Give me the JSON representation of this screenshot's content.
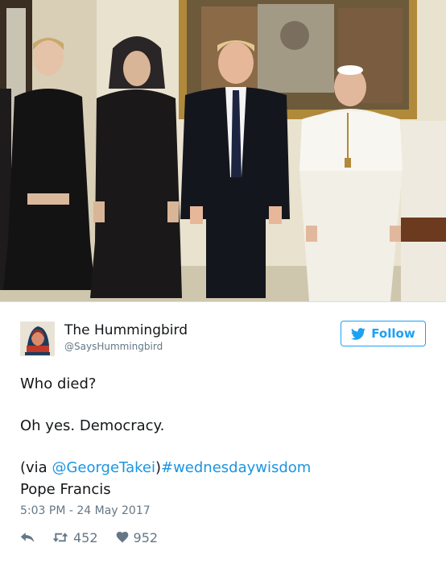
{
  "photo": {
    "subject": "photograph-of-four-people"
  },
  "tweet": {
    "author_name": "The Hummingbird",
    "author_handle": "@SaysHummingbird",
    "follow_label": "Follow",
    "text_line1": "Who died?",
    "text_line2": "Oh yes. Democracy.",
    "via_open": "(via ",
    "mention": "@GeorgeTakei",
    "via_close": ")",
    "hashtag": "#wednesdaywisdom",
    "text_line4": "Pope Francis",
    "timestamp": "5:03 PM - 24 May 2017",
    "retweet_count": "452",
    "like_count": "952"
  },
  "colors": {
    "twitter_blue": "#1da1f2",
    "link_blue": "#1b95e0",
    "secondary_text": "#657786",
    "primary_text": "#14171a"
  },
  "icons": {
    "reply": "reply-icon",
    "retweet": "retweet-icon",
    "like": "heart-icon",
    "follow": "twitter-bird-icon"
  }
}
